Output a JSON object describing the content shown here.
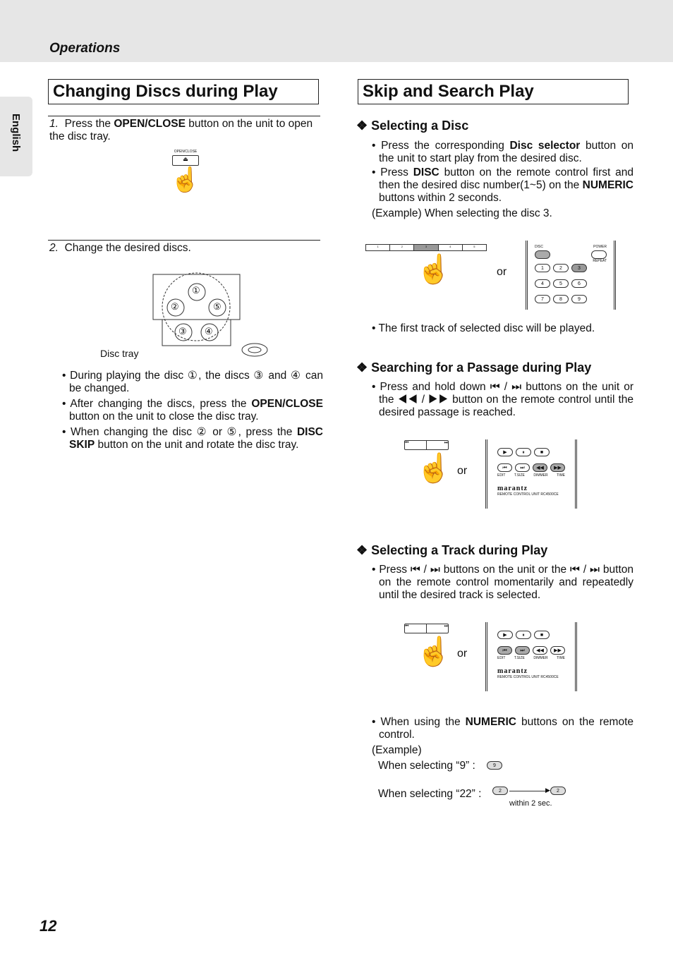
{
  "header": {
    "section": "Operations",
    "side_tab": "English"
  },
  "left": {
    "title": "Changing Discs during Play",
    "step1": {
      "num": "1.",
      "pre": "Press the ",
      "bold": "OPEN/CLOSE",
      "post": " button on the unit to open the disc tray.",
      "figure_label": "OPEN/CLOSE"
    },
    "step2": {
      "num": "2.",
      "text": "Change the desired discs.",
      "figure_label": "Disc tray",
      "discs": [
        "①",
        "②",
        "③",
        "④",
        "⑤"
      ]
    },
    "bullets": [
      {
        "text": "During playing the disc ①, the discs ③ and ④ can be changed."
      },
      {
        "pre": "After changing the discs, press the ",
        "bold": "OPEN/CLOSE",
        "post": " button on the unit to close the disc tray."
      },
      {
        "pre": "When changing the disc ② or ⑤, press the ",
        "bold": "DISC SKIP",
        "post": " button on the unit and rotate the disc tray."
      }
    ]
  },
  "right": {
    "title": "Skip and Search Play",
    "select_disc": {
      "heading": "Selecting a Disc",
      "b1": {
        "pre": "Press the corresponding ",
        "bold": "Disc selector",
        "post": " button on the unit to start play from the desired disc."
      },
      "b2": {
        "pre": "Press ",
        "bold": "DISC",
        "mid": " button on the remote control first and then the desired disc number(1~5) on the ",
        "bold2": "NUMERIC",
        "post": " buttons within 2 seconds."
      },
      "example": "(Example) When selecting the disc 3.",
      "or": "or",
      "unit_buttons": [
        "1",
        "2",
        "3",
        "4",
        "5"
      ],
      "remote_labels": {
        "disc": "DISC",
        "power": "POWER",
        "repeat": "REPEAT"
      },
      "remote_keys": [
        "1",
        "2",
        "3",
        "4",
        "5",
        "6",
        "7",
        "8",
        "9"
      ],
      "note": "The first track of selected disc will be played."
    },
    "search": {
      "heading": "Searching for a Passage during Play",
      "text": "Press and hold down ⏮ / ⏭ buttons on the unit or the ◀◀ / ▶▶ button on the remote control until the desired passage is reached.",
      "or": "or",
      "remote_labels": [
        "EDIT",
        "T.SIZE",
        "DIMMER",
        "TIME"
      ],
      "brand": "marantz",
      "remote_model": "REMOTE CONTROL UNIT RC4500CE"
    },
    "track": {
      "heading": "Selecting a Track during Play",
      "text": "Press ⏮ / ⏭ buttons on the unit or the ⏮ / ⏭ button on the remote control momentarily and repeatedly until the desired track is selected.",
      "or": "or",
      "numeric": {
        "pre": "When using the ",
        "bold": "NUMERIC",
        "post": " buttons on the remote control."
      },
      "example": "(Example)",
      "ex9": "When selecting “9” :",
      "key9": "9",
      "ex22": "When selecting “22” :",
      "key2": "2",
      "within": "within 2 sec."
    }
  },
  "page_number": "12"
}
